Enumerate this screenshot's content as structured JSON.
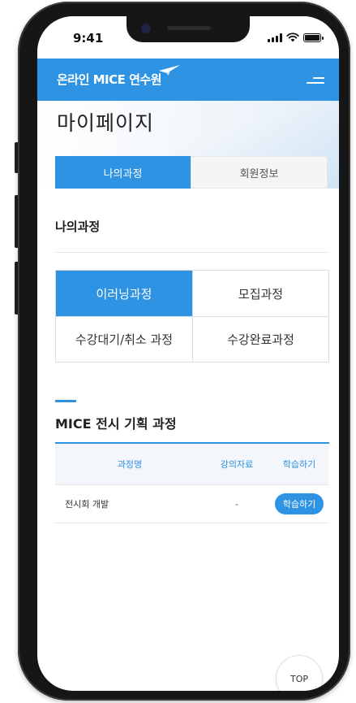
{
  "status_bar": {
    "time": "9:41"
  },
  "app_header": {
    "logo_text": "온라인 MICE 연수원"
  },
  "page": {
    "title": "마이페이지",
    "tabs": [
      {
        "label": "나의과정",
        "active": true
      },
      {
        "label": "회원정보",
        "active": false
      }
    ]
  },
  "my_courses": {
    "heading": "나의과정",
    "categories": [
      {
        "label": "이러닝과정",
        "active": true
      },
      {
        "label": "모집과정",
        "active": false
      },
      {
        "label": "수강대기/취소 과정",
        "active": false
      },
      {
        "label": "수강완료과정",
        "active": false
      }
    ]
  },
  "course_section": {
    "heading": "MICE 전시 기획 과정",
    "columns": [
      "과정명",
      "강의자료",
      "학습하기"
    ],
    "rows": [
      {
        "name": "전시회 개발",
        "material": "-",
        "action": "학습하기"
      }
    ]
  },
  "top_button": {
    "label": "TOP"
  },
  "colors": {
    "accent": "#2f93e4",
    "frame": "#161616"
  },
  "icons": [
    "signal-icon",
    "wifi-icon",
    "battery-icon",
    "paper-plane-icon",
    "hamburger-menu-icon"
  ]
}
